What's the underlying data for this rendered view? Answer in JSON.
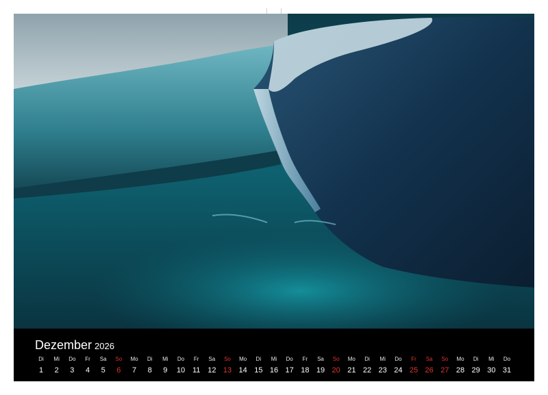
{
  "calendar": {
    "month": "Dezember",
    "year": "2026",
    "weekend_color": "#e0352b",
    "days": [
      {
        "wd": "Di",
        "n": "1",
        "red": false
      },
      {
        "wd": "Mi",
        "n": "2",
        "red": false
      },
      {
        "wd": "Do",
        "n": "3",
        "red": false
      },
      {
        "wd": "Fr",
        "n": "4",
        "red": false
      },
      {
        "wd": "Sa",
        "n": "5",
        "red": false
      },
      {
        "wd": "So",
        "n": "6",
        "red": true
      },
      {
        "wd": "Mo",
        "n": "7",
        "red": false
      },
      {
        "wd": "Di",
        "n": "8",
        "red": false
      },
      {
        "wd": "Mi",
        "n": "9",
        "red": false
      },
      {
        "wd": "Do",
        "n": "10",
        "red": false
      },
      {
        "wd": "Fr",
        "n": "11",
        "red": false
      },
      {
        "wd": "Sa",
        "n": "12",
        "red": false
      },
      {
        "wd": "So",
        "n": "13",
        "red": true
      },
      {
        "wd": "Mo",
        "n": "14",
        "red": false
      },
      {
        "wd": "Di",
        "n": "15",
        "red": false
      },
      {
        "wd": "Mi",
        "n": "16",
        "red": false
      },
      {
        "wd": "Do",
        "n": "17",
        "red": false
      },
      {
        "wd": "Fr",
        "n": "18",
        "red": false
      },
      {
        "wd": "Sa",
        "n": "19",
        "red": false
      },
      {
        "wd": "So",
        "n": "20",
        "red": true
      },
      {
        "wd": "Mo",
        "n": "21",
        "red": false
      },
      {
        "wd": "Di",
        "n": "22",
        "red": false
      },
      {
        "wd": "Mi",
        "n": "23",
        "red": false
      },
      {
        "wd": "Do",
        "n": "24",
        "red": false
      },
      {
        "wd": "Fr",
        "n": "25",
        "red": true
      },
      {
        "wd": "Sa",
        "n": "26",
        "red": true
      },
      {
        "wd": "So",
        "n": "27",
        "red": true
      },
      {
        "wd": "Mo",
        "n": "28",
        "red": false
      },
      {
        "wd": "Di",
        "n": "29",
        "red": false
      },
      {
        "wd": "Mi",
        "n": "30",
        "red": false
      },
      {
        "wd": "Do",
        "n": "31",
        "red": false
      }
    ]
  },
  "photo": {
    "subject": "iceberg-in-polar-sea"
  }
}
